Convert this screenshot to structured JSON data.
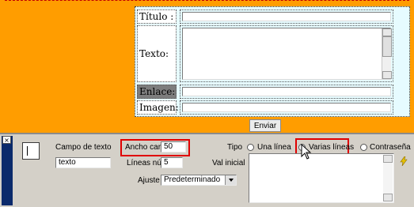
{
  "form": {
    "rows": [
      {
        "label": "Título :"
      },
      {
        "label": "Texto:"
      },
      {
        "label": "Enlace:"
      },
      {
        "label": "Imagen:"
      }
    ],
    "submit_label": "Enviar"
  },
  "inspector": {
    "field_type_label": "Campo de texto",
    "field_name": "texto",
    "width_label": "Ancho car",
    "width_value": "50",
    "lines_label": "Líneas núm",
    "lines_value": "5",
    "wrap_label": "Ajuste",
    "wrap_value": "Predeterminado",
    "type_label": "Tipo",
    "type_options": [
      "Una línea",
      "Varias líneas",
      "Contraseña"
    ],
    "type_selected": "Varias líneas",
    "initial_label": "Val inicial",
    "close_glyph": "×"
  },
  "colors": {
    "design_background": "#ff9d00",
    "form_background": "#e6fbff",
    "inspector_background": "#d4d0c8",
    "highlight_red": "#e00000",
    "sidebar_strip": "#0b2a6b"
  },
  "icons": [
    "text-field-icon",
    "close-icon",
    "lightning-bolt-icon",
    "mouse-cursor-icon",
    "dropdown-arrow-icon"
  ]
}
